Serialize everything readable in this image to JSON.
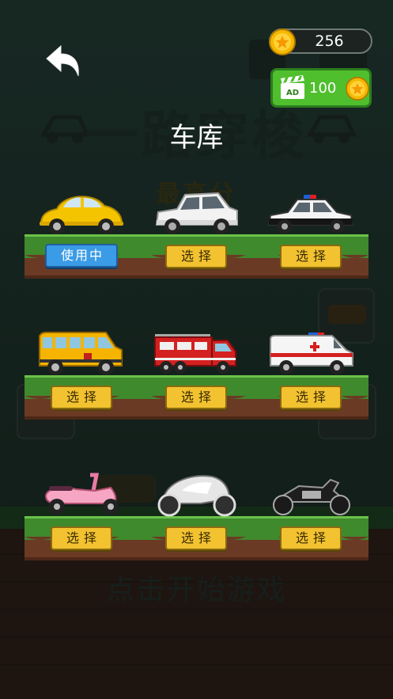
{
  "background": {
    "game_title": "一路穿梭",
    "best_score_label": "最高分",
    "start_prompt": "点击开始游戏"
  },
  "header": {
    "back_icon": "back-arrow-icon",
    "coins": "256",
    "ad_reward": "100",
    "ad_icon_text": "AD"
  },
  "page_title": "车库",
  "garage": [
    {
      "vehicle": "yellow-beetle-car",
      "button": "使用中",
      "active": true
    },
    {
      "vehicle": "white-hatchback-car",
      "button": "选择",
      "active": false
    },
    {
      "vehicle": "police-car",
      "button": "选择",
      "active": false
    },
    {
      "vehicle": "school-bus",
      "button": "选择",
      "active": false
    },
    {
      "vehicle": "fire-truck",
      "button": "选择",
      "active": false
    },
    {
      "vehicle": "ambulance",
      "button": "选择",
      "active": false
    },
    {
      "vehicle": "pink-scooter",
      "button": "选择",
      "active": false
    },
    {
      "vehicle": "futuristic-bike",
      "button": "选择",
      "active": false
    },
    {
      "vehicle": "motorcycle",
      "button": "选择",
      "active": false
    }
  ],
  "colors": {
    "grass": "#3f8a2c",
    "soil": "#6b3a24",
    "select_button": "#f2c230",
    "active_button": "#3a9be6",
    "ad_button": "#4fbf2e"
  }
}
